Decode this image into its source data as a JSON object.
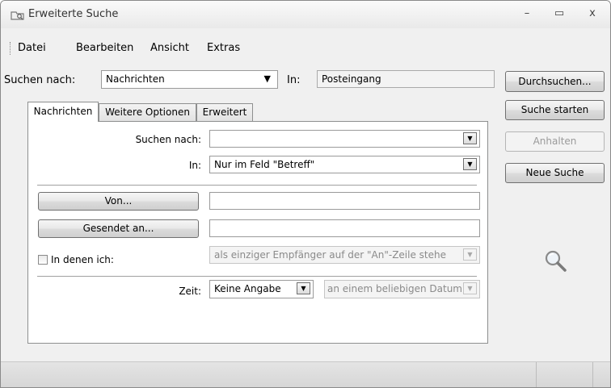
{
  "window": {
    "title": "Erweiterte Suche",
    "controls": {
      "minimize": "–",
      "maximize": "▭",
      "close": "x"
    }
  },
  "menu": [
    "Datei",
    "Bearbeiten",
    "Ansicht",
    "Extras"
  ],
  "top": {
    "search_for_label": "Suchen nach:",
    "search_for_value": "Nachrichten",
    "in_label": "In:",
    "in_value": "Posteingang",
    "browse_button": "Durchsuchen..."
  },
  "actions": {
    "start": "Suche starten",
    "stop": "Anhalten",
    "new": "Neue Suche"
  },
  "tabs": [
    "Nachrichten",
    "Weitere Optionen",
    "Erweitert"
  ],
  "form": {
    "search_for_label": "Suchen nach:",
    "search_for_value": "",
    "in_label": "In:",
    "in_value": "Nur im Feld \"Betreff\"",
    "from_button": "Von...",
    "from_value": "",
    "sent_to_button": "Gesendet an...",
    "sent_to_value": "",
    "where_i_label": "In denen ich:",
    "where_i_checked": false,
    "where_i_value": "als einziger Empfänger auf der \"An\"-Zeile stehe",
    "time_label": "Zeit:",
    "time_value": "Keine Angabe",
    "date_value": "an einem beliebigen Datum"
  },
  "icons": {
    "app": "search-folder-icon",
    "search": "magnifier-icon",
    "dropdown": "chevron-down-icon"
  }
}
